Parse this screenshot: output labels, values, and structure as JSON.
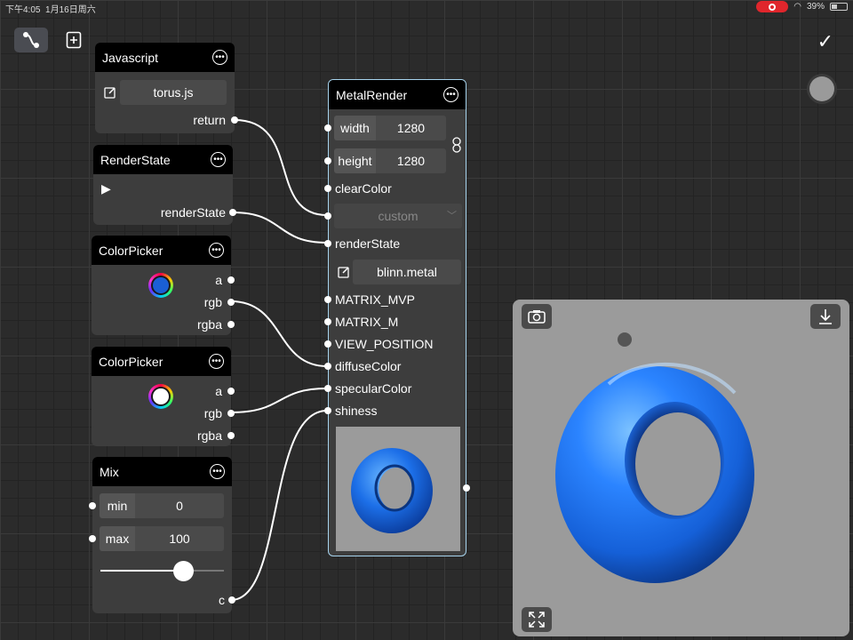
{
  "status": {
    "time": "下午4:05",
    "date": "1月16日周六",
    "battery": "39%"
  },
  "toolbar": {
    "confirm_icon": "checkmark-icon",
    "graph_icon": "graph-icon",
    "add_icon": "add-node-icon"
  },
  "nodes": {
    "javascript": {
      "title": "Javascript",
      "file": "torus.js",
      "output": "return"
    },
    "renderstate": {
      "title": "RenderState",
      "output": "renderState"
    },
    "colorpicker1": {
      "title": "ColorPicker",
      "outputs": [
        "a",
        "rgb",
        "rgba"
      ],
      "color": "#1a5fd6"
    },
    "colorpicker2": {
      "title": "ColorPicker",
      "outputs": [
        "a",
        "rgb",
        "rgba"
      ],
      "color": "#ffffff"
    },
    "mix": {
      "title": "Mix",
      "min_label": "min",
      "min_value": "0",
      "max_label": "max",
      "max_value": "100",
      "output": "c",
      "slider_level": 0.67
    },
    "metalrender": {
      "title": "MetalRender",
      "width_label": "width",
      "width_value": "1280",
      "height_label": "height",
      "height_value": "1280",
      "clear_color": "clearColor",
      "dropdown_value": "custom",
      "render_state": "renderState",
      "shader_file": "blinn.metal",
      "inputs": [
        "MATRIX_MVP",
        "MATRIX_M",
        "VIEW_POSITION",
        "diffuseColor",
        "specularColor",
        "shiness"
      ]
    }
  },
  "colors": {
    "accent_border": "#a7d4ee",
    "torus": "#1c6fe8",
    "background": "#2b2b2b"
  }
}
